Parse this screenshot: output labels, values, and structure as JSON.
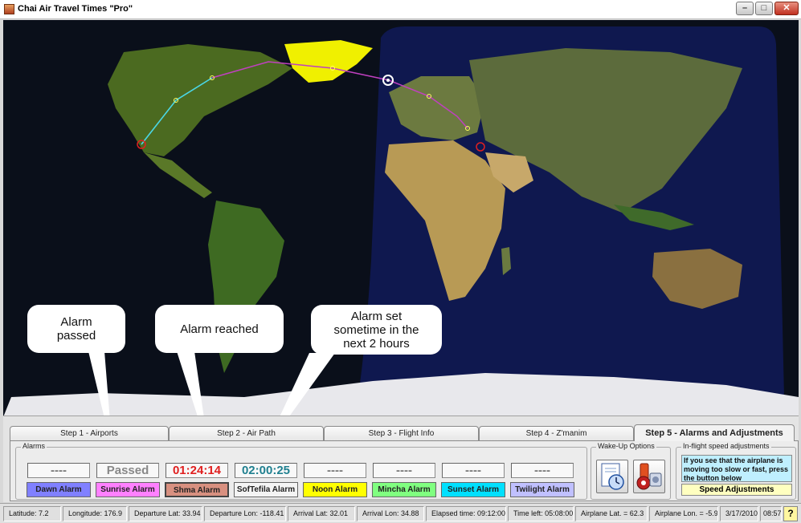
{
  "window": {
    "title": "Chai Air Travel Times \"Pro\""
  },
  "window_controls": {
    "minimize": "–",
    "maximize": "□",
    "close": "✕"
  },
  "callouts": {
    "passed": "Alarm passed",
    "reached": "Alarm reached",
    "set": "Alarm set sometime in the next 2 hours"
  },
  "tabs": [
    {
      "label": "Step 1 - Airports"
    },
    {
      "label": "Step 2 - Air Path"
    },
    {
      "label": "Step 3 - Flight Info"
    },
    {
      "label": "Step 4 - Z'manim"
    },
    {
      "label": "Step 5 - Alarms and Adjustments"
    }
  ],
  "alarms_group_label": "Alarms",
  "alarms": [
    {
      "display": "----",
      "button": "Dawn Alarm",
      "display_color": "#777777",
      "button_color": "#8080ff"
    },
    {
      "display": "Passed",
      "button": "Sunrise Alarm",
      "display_color": "#888888",
      "button_color": "#ff80ff"
    },
    {
      "display": "01:24:14",
      "button": "Shma Alarm",
      "display_color": "#e02020",
      "button_color": "#d89080"
    },
    {
      "display": "02:00:25",
      "button": "SofTefila Alarm",
      "display_color": "#208090",
      "button_color": "#f4f4f4"
    },
    {
      "display": "----",
      "button": "Noon Alarm",
      "display_color": "#777777",
      "button_color": "#ffff00"
    },
    {
      "display": "----",
      "button": "Mincha Alarm",
      "display_color": "#777777",
      "button_color": "#80ff80"
    },
    {
      "display": "----",
      "button": "Sunset Alarm",
      "display_color": "#777777",
      "button_color": "#00e0ff"
    },
    {
      "display": "----",
      "button": "Twilight Alarm",
      "display_color": "#777777",
      "button_color": "#c0c0ff"
    }
  ],
  "wakeup_group_label": "Wake-Up Options",
  "speed_group_label": "In-flight speed adjustments",
  "speed_info": "If you see that the airplane is moving too slow or fast, press the button below",
  "speed_button": "Speed Adjustments",
  "status": [
    "Latitude: 7.2",
    "Longitude: 176.9",
    "Departure Lat: 33.94",
    "Departure Lon: -118.41",
    "Arrival Lat: 32.01",
    "Arrival Lon: 34.88",
    "Elapsed time: 09:12:00",
    "Time left: 05:08:00",
    "Airplane Lat. = 62.3",
    "Airplane Lon. = -5.9",
    "3/17/2010",
    "08:57"
  ],
  "help_label": "?"
}
